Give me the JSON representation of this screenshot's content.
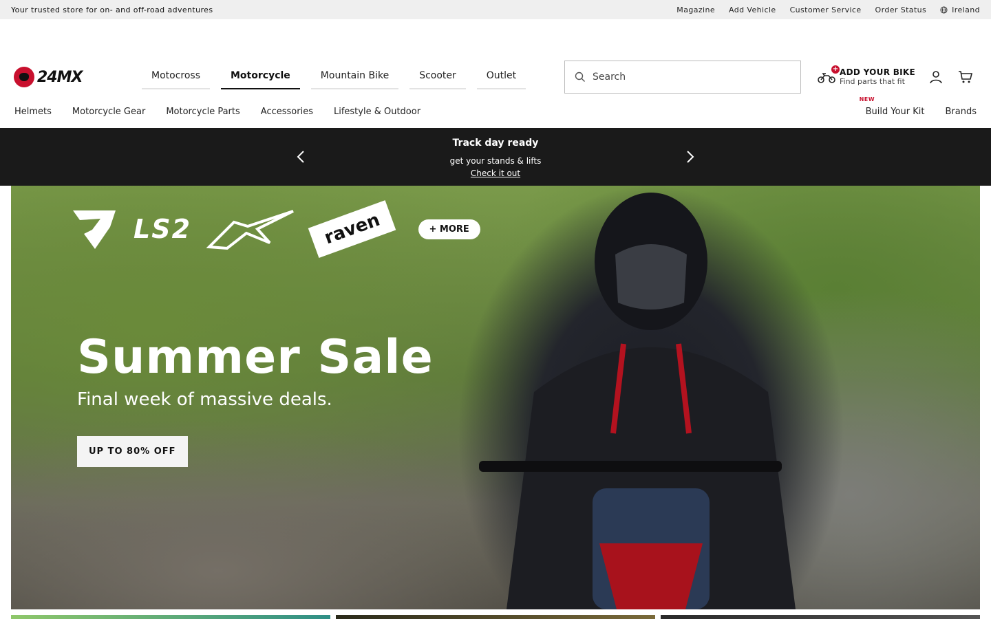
{
  "topbar": {
    "tagline": "Your trusted store for on- and off-road adventures",
    "links": [
      "Magazine",
      "Add Vehicle",
      "Customer Service",
      "Order Status"
    ],
    "region": "Ireland"
  },
  "header": {
    "logo_text": "24MX",
    "main_tabs": [
      {
        "label": "Motocross",
        "active": false
      },
      {
        "label": "Motorcycle",
        "active": true
      },
      {
        "label": "Mountain Bike",
        "active": false
      },
      {
        "label": "Scooter",
        "active": false
      },
      {
        "label": "Outlet",
        "active": false
      }
    ],
    "search": {
      "placeholder": "Search"
    },
    "add_bike": {
      "title": "ADD YOUR BIKE",
      "subtitle": "Find parts that fit",
      "badge": "+"
    }
  },
  "subnav": {
    "left": [
      "Helmets",
      "Motorcycle Gear",
      "Motorcycle Parts",
      "Accessories",
      "Lifestyle & Outdoor"
    ],
    "new_badge": "NEW",
    "right": [
      "Build Your Kit",
      "Brands"
    ]
  },
  "promo": {
    "title": "Track day ready",
    "subtitle": "get your stands & lifts",
    "link": "Check it out"
  },
  "hero": {
    "brands": [
      "LS2",
      "raven"
    ],
    "more": "+ MORE",
    "heading": "Summer Sale",
    "subheading": "Final week of massive deals.",
    "cta": "UP TO 80% OFF"
  },
  "colors": {
    "accent": "#c8102e",
    "promo_bg": "#1a1a1a"
  }
}
